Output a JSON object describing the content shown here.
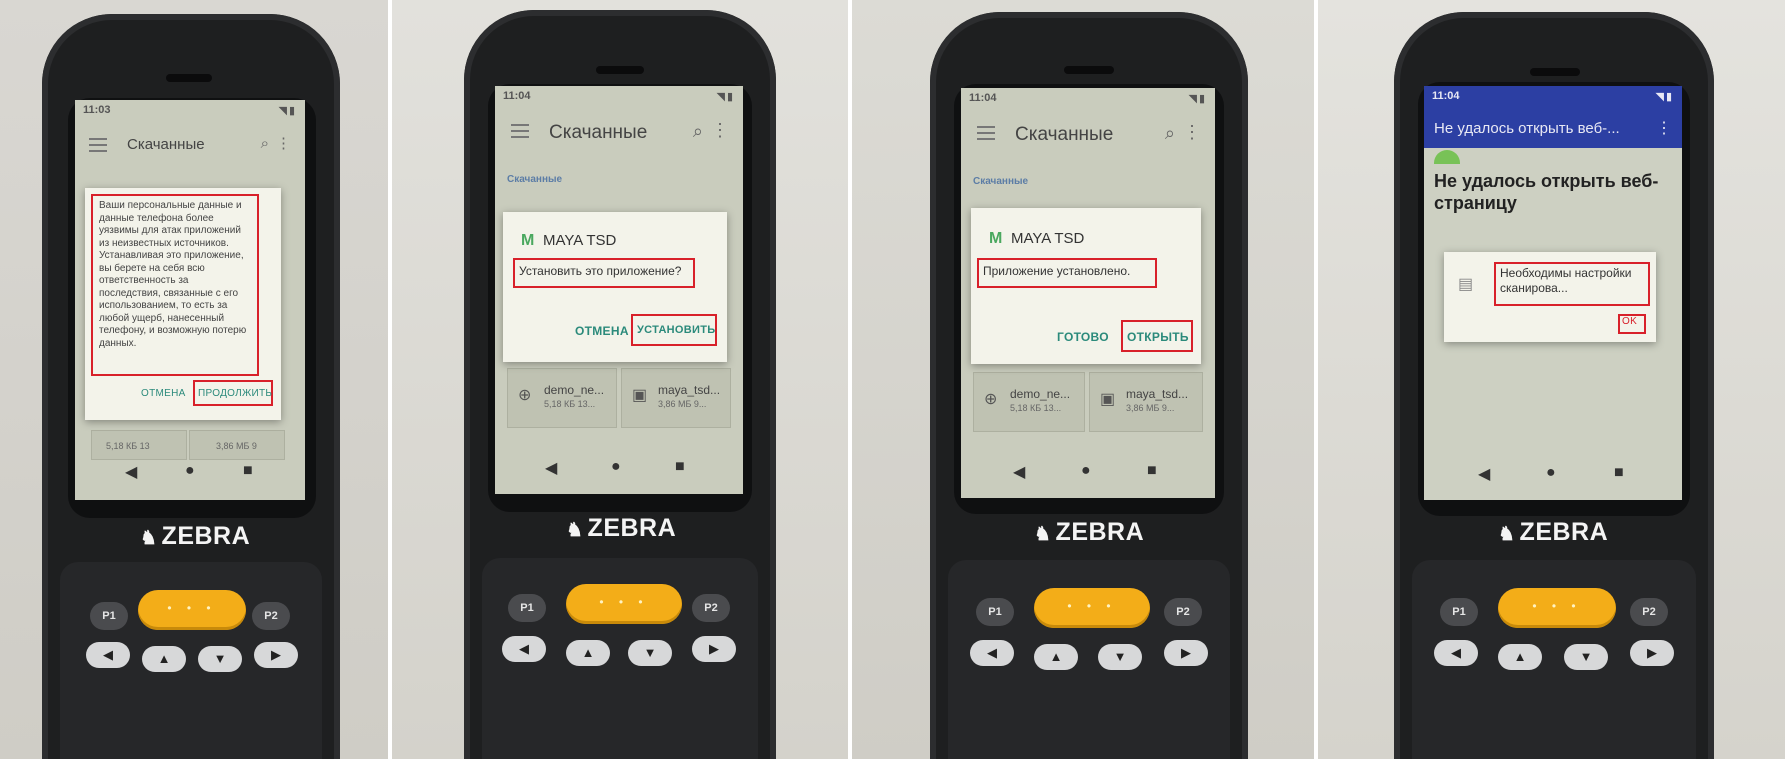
{
  "brand": "ZEBRA",
  "colors": {
    "highlight": "#d8202a",
    "dialog_button": "#2b8a7b",
    "scan_key": "#f3ad18",
    "error_appbar": "#2c3fa3",
    "android_green": "#78c257"
  },
  "keypad": {
    "p1": "P1",
    "p2": "P2",
    "scan_dots": "• • •",
    "arrows": [
      "◀",
      "▲",
      "▼",
      "▶"
    ]
  },
  "screens": [
    {
      "status_time": "11:03",
      "app_title": "Скачанные",
      "dialog": {
        "message": "Ваши персональные данные и данные телефона более уязвимы для атак приложений из неизвестных источников. Устанавливая это приложение, вы берете на себя всю ответственность за последствия, связанные с его использованием, то есть за любой ущерб, нанесенный телефону, и возможную потерю данных.",
        "cancel": "ОТМЕНА",
        "confirm": "ПРОДОЛЖИТЬ"
      },
      "files": [
        {
          "meta": "5,18 КБ 13"
        },
        {
          "meta": "3,86 МБ 9"
        }
      ]
    },
    {
      "status_time": "11:04",
      "app_title": "Скачанные",
      "section_label": "Скачанные",
      "dialog": {
        "app_name": "MAYA TSD",
        "message": "Установить это приложение?",
        "cancel": "ОТМЕНА",
        "confirm": "УСТАНОВИТЬ"
      },
      "files": [
        {
          "name": "demo_ne...",
          "meta": "5,18 КБ 13..."
        },
        {
          "name": "maya_tsd...",
          "meta": "3,86 МБ 9..."
        }
      ]
    },
    {
      "status_time": "11:04",
      "app_title": "Скачанные",
      "section_label": "Скачанные",
      "dialog": {
        "app_name": "MAYA TSD",
        "message": "Приложение установлено.",
        "cancel": "ГОТОВО",
        "confirm": "ОТКРЫТЬ"
      },
      "files": [
        {
          "name": "demo_ne...",
          "meta": "5,18 КБ 13..."
        },
        {
          "name": "maya_tsd...",
          "meta": "3,86 МБ 9..."
        }
      ]
    },
    {
      "status_time": "11:04",
      "app_title": "Не удалось открыть веб-...",
      "page_heading": "Не удалось открыть веб-страницу",
      "dialog": {
        "message": "Необходимы настройки сканирова...",
        "confirm": "OK"
      }
    }
  ]
}
